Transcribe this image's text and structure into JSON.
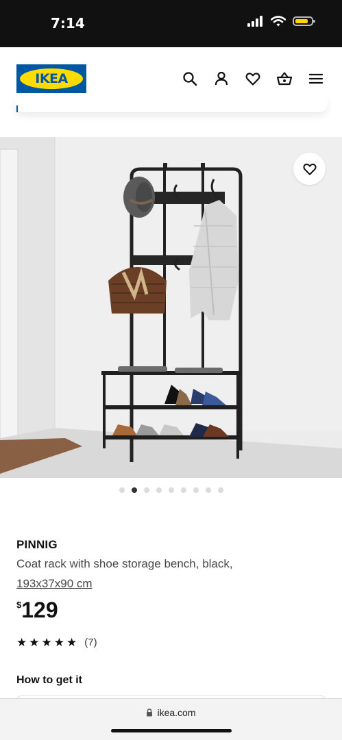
{
  "status_bar": {
    "time": "7:14"
  },
  "header": {
    "logo_text": "IKEA",
    "actions": [
      {
        "name": "search",
        "icon": "search-icon"
      },
      {
        "name": "account",
        "icon": "person-icon"
      },
      {
        "name": "favourites",
        "icon": "heart-icon"
      },
      {
        "name": "cart",
        "icon": "basket-icon"
      },
      {
        "name": "menu",
        "icon": "hamburger-icon"
      }
    ]
  },
  "gallery": {
    "image_count": 9,
    "active_index": 1,
    "favourite_icon": "heart-icon"
  },
  "product": {
    "name": "PINNIG",
    "description": "Coat rack with shoe storage bench, black,",
    "size": "193x37x90 cm",
    "price_currency": "$",
    "price_value": "129",
    "rating_stars": 5,
    "rating_count": "(7)"
  },
  "how_to_get": {
    "title": "How to get it"
  },
  "browser": {
    "url": "ikea.com",
    "lock_icon": "lock-icon"
  },
  "colors": {
    "ikea_blue": "#0058a3",
    "ikea_yellow": "#ffdb00",
    "battery_yellow": "#ffd400"
  }
}
